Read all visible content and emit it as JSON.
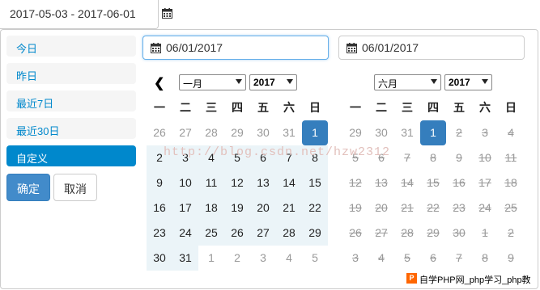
{
  "top": {
    "range_value": "2017-05-03 - 2017-06-01"
  },
  "ranges": [
    "今日",
    "昨日",
    "最近7日",
    "最近30日",
    "自定义"
  ],
  "active_range_index": 4,
  "buttons": {
    "ok": "确定",
    "cancel": "取消"
  },
  "left": {
    "start_input": "06/01/2017",
    "month": "一月",
    "year": "2017",
    "weekdays": [
      "一",
      "二",
      "三",
      "四",
      "五",
      "六",
      "日"
    ],
    "weeks": [
      [
        "26",
        "27",
        "28",
        "29",
        "30",
        "31",
        "1"
      ],
      [
        "2",
        "3",
        "4",
        "5",
        "6",
        "7",
        "8"
      ],
      [
        "9",
        "10",
        "11",
        "12",
        "13",
        "14",
        "15"
      ],
      [
        "16",
        "17",
        "18",
        "19",
        "20",
        "21",
        "22"
      ],
      [
        "23",
        "24",
        "25",
        "26",
        "27",
        "28",
        "29"
      ],
      [
        "30",
        "31",
        "1",
        "2",
        "3",
        "4",
        "5"
      ]
    ]
  },
  "right": {
    "end_input": "06/01/2017",
    "month": "六月",
    "year": "2017",
    "weekdays": [
      "一",
      "二",
      "三",
      "四",
      "五",
      "六",
      "日"
    ],
    "weeks": [
      [
        "29",
        "30",
        "31",
        "1",
        "2",
        "3",
        "4"
      ],
      [
        "5",
        "6",
        "7",
        "8",
        "9",
        "10",
        "11"
      ],
      [
        "12",
        "13",
        "14",
        "15",
        "16",
        "17",
        "18"
      ],
      [
        "19",
        "20",
        "21",
        "22",
        "23",
        "24",
        "25"
      ],
      [
        "26",
        "27",
        "28",
        "29",
        "30",
        "1",
        "2"
      ],
      [
        "3",
        "4",
        "5",
        "6",
        "7",
        "8",
        "9"
      ]
    ]
  },
  "watermark": "http://blog.csdn.net/hzw2312",
  "badge": {
    "logo": "P",
    "text": "自学PHP网_php学习_php教"
  },
  "colors": {
    "accent": "#08c",
    "selected": "#357ebd",
    "range": "#ebf4f8"
  }
}
